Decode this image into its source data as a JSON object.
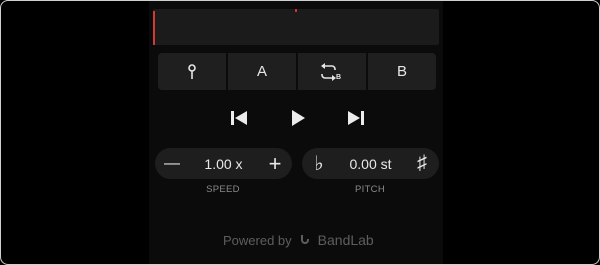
{
  "loop_bar": {
    "items": [
      {
        "name": "marker-icon",
        "label": ""
      },
      {
        "name": "a-point",
        "label": "A"
      },
      {
        "name": "loop-ab-icon",
        "label": ""
      },
      {
        "name": "b-point",
        "label": "B"
      }
    ],
    "loop_icon_subscript": "B"
  },
  "transport": {
    "prev_icon": "skip-previous-icon",
    "play_icon": "play-icon",
    "next_icon": "skip-next-icon"
  },
  "speed": {
    "value": "1.00 x",
    "caption": "SPEED",
    "decrease_symbol": "—",
    "increase_symbol": "+"
  },
  "pitch": {
    "value": "0.00 st",
    "caption": "PITCH",
    "flat_symbol": "♭",
    "sharp_symbol": "♯"
  },
  "footer": {
    "powered_by": "Powered by",
    "brand": "BandLab"
  },
  "colors": {
    "playhead": "#d43a2f",
    "panel": "#0b0b0b",
    "button_bg": "#1f1f1f"
  }
}
